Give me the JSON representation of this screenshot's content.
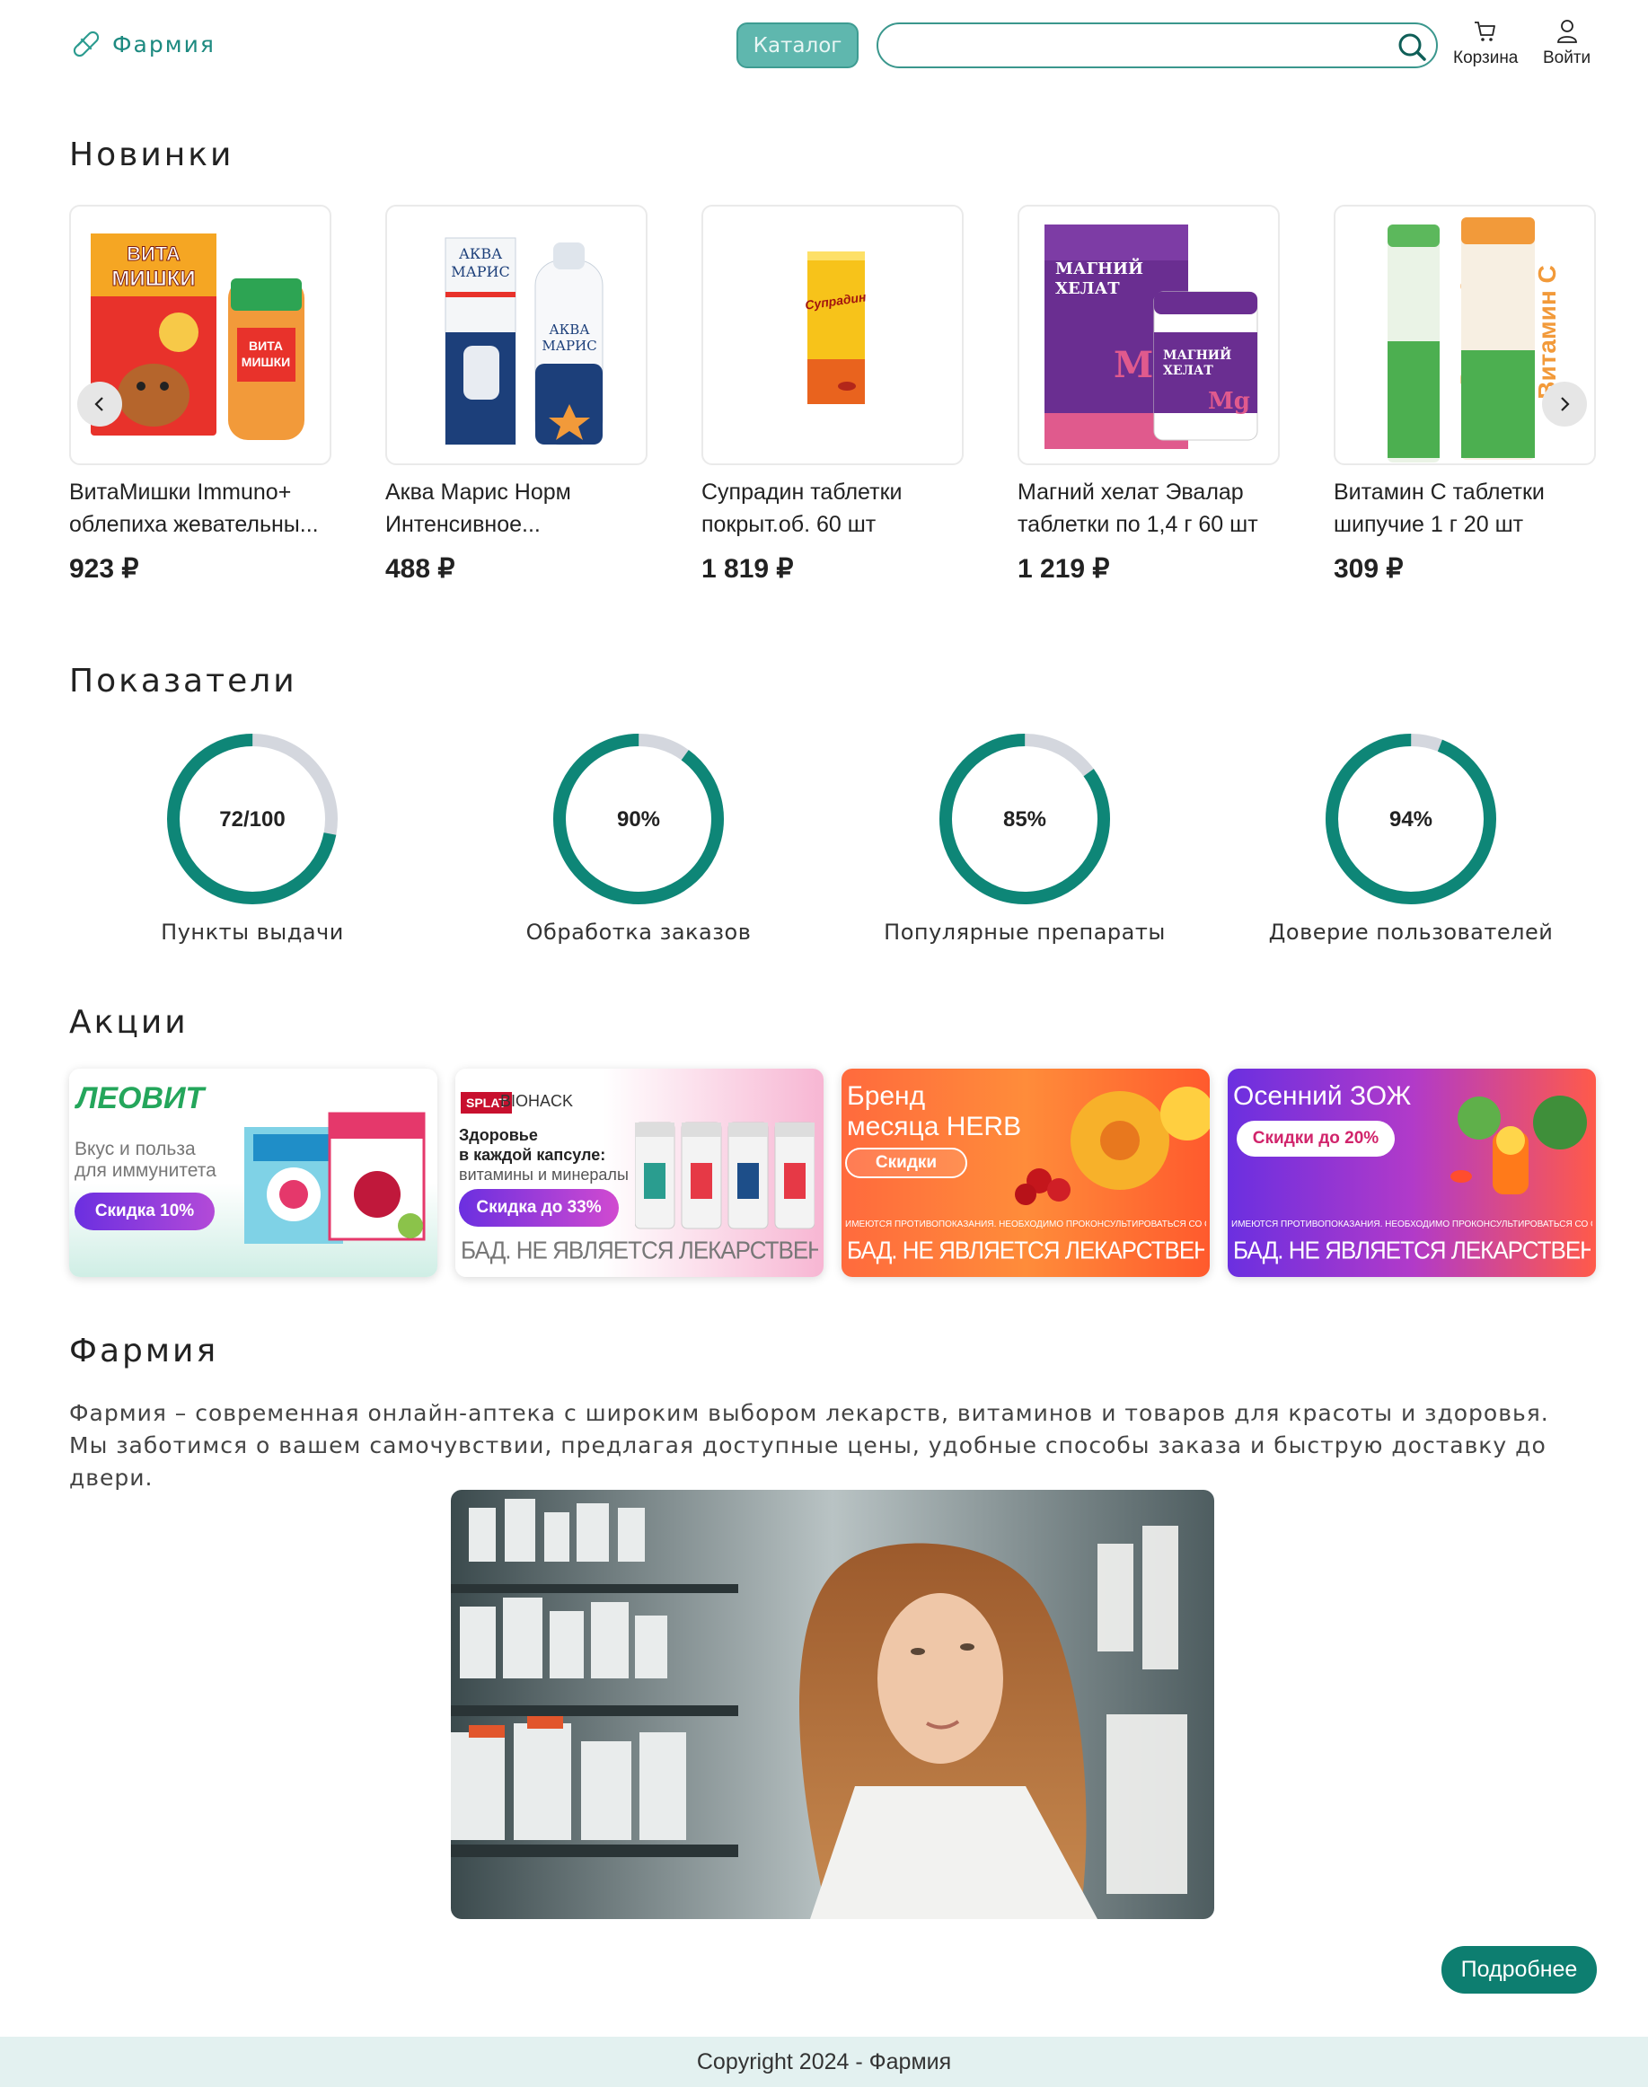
{
  "header": {
    "logo_text": "Фармия",
    "catalog_label": "Каталог",
    "search_value": "",
    "cart_label": "Корзина",
    "login_label": "Войти"
  },
  "new_section": {
    "title": "Новинки",
    "products": [
      {
        "name": "ВитаМишки Immuno+ облепиха жевательны...",
        "price": "923 ₽",
        "box_text": "ВИТА МИШКИ"
      },
      {
        "name": "Аква Марис Норм Интенсивное...",
        "price": "488 ₽",
        "box_text": "АКВА МАРИС"
      },
      {
        "name": "Супрадин таблетки покрыт.об. 60 шт",
        "price": "1 819 ₽",
        "box_text": "Супрадин"
      },
      {
        "name": "Магний хелат Эвалар таблетки по 1,4 г 60 шт",
        "price": "1 219 ₽",
        "box_text": "МАГНИЙ ХЕЛАТ"
      },
      {
        "name": "Витамин С таблетки шипучие 1 г 20 шт",
        "price": "309 ₽",
        "box_text": "Витамин С"
      }
    ]
  },
  "stats_section": {
    "title": "Показатели",
    "stats": [
      {
        "value_text": "72/100",
        "fraction": 0.72,
        "label": "Пункты выдачи"
      },
      {
        "value_text": "90%",
        "fraction": 0.9,
        "label": "Обработка заказов"
      },
      {
        "value_text": "85%",
        "fraction": 0.85,
        "label": "Популярные препараты"
      },
      {
        "value_text": "94%",
        "fraction": 0.94,
        "label": "Доверие пользователей"
      }
    ],
    "ring_color": "#0e8677",
    "track_color": "#d4d7de"
  },
  "promos_section": {
    "title": "Акции",
    "promos": [
      {
        "brand": "ЛЕОВИТ",
        "line1": "Вкус и польза",
        "line2": "для иммунитета",
        "badge": "Скидка 10%"
      },
      {
        "brand": "BIOHACK",
        "line1": "Здоровье",
        "line2": "в каждой капсуле:",
        "line3": "витамины и минералы",
        "badge": "Скидка до 33%",
        "disclaimer": "БАД. НЕ ЯВЛЯЕТСЯ ЛЕКАРСТВЕННЫМ СРЕДСТВОМ"
      },
      {
        "line1": "Бренд",
        "line2": "месяца HERB",
        "badge": "Скидки",
        "warning": "ИМЕЮТСЯ ПРОТИВОПОКАЗАНИЯ. НЕОБХОДИМО ПРОКОНСУЛЬТИРОВАТЬСЯ СО СПЕЦИАЛИСТОМ",
        "disclaimer": "БАД. НЕ ЯВЛЯЕТСЯ ЛЕКАРСТВЕННЫМ СРЕДСТВОМ"
      },
      {
        "line1": "Осенний ЗОЖ",
        "badge": "Скидки до 20%",
        "warning": "ИМЕЮТСЯ ПРОТИВОПОКАЗАНИЯ. НЕОБХОДИМО ПРОКОНСУЛЬТИРОВАТЬСЯ СО СПЕЦИАЛИСТОМ",
        "disclaimer": "БАД. НЕ ЯВЛЯЕТСЯ ЛЕКАРСТВЕННЫМ СРЕДСТВОМ"
      }
    ]
  },
  "about_section": {
    "title": "Фармия",
    "text": "Фармия – современная онлайн-аптека с широким выбором лекарств, витаминов и товаров для красоты и здоровья. Мы заботимся о вашем самочувствии, предлагая доступные цены, удобные способы заказа и быструю доставку до двери.",
    "more_label": "Подробнее"
  },
  "footer": {
    "text": "Copyright 2024 - Фармия"
  },
  "colors": {
    "brand": "#1d8a80",
    "button": "#0d7e70",
    "footer_bg": "#e3f1f0"
  }
}
